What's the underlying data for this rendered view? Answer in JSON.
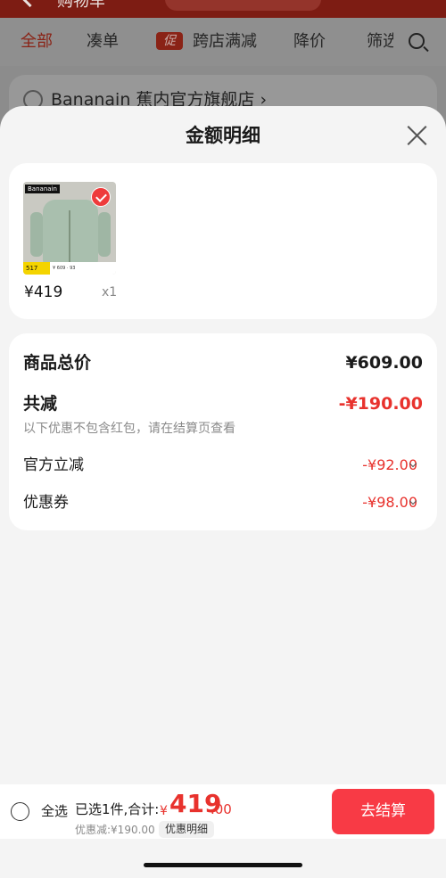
{
  "background": {
    "header_title": "购物车",
    "tabs": [
      "全部",
      "凑单",
      "跨店满减",
      "降价",
      "筛选"
    ],
    "promo_badge": "促",
    "store_name": "Bananain 蕉内官方旗舰店 ›"
  },
  "sheet": {
    "title": "金额明细",
    "product": {
      "price": "¥419",
      "quantity": "x1",
      "thumb_brand": "Bananain",
      "thumb_badge": "517",
      "thumb_strip": "¥ 609 · 93"
    },
    "breakdown": {
      "total_label": "商品总价",
      "total_value": "¥609.00",
      "reduce_label": "共减",
      "reduce_value": "-¥190.00",
      "reduce_note": "以下优惠不包含红包，请在结算页查看",
      "items": [
        {
          "label": "官方立减",
          "value": "-¥92.00"
        },
        {
          "label": "优惠券",
          "value": "-¥98.00"
        }
      ]
    }
  },
  "bottom_bar": {
    "select_all": "全选",
    "summary": "已选1件,合计:",
    "currency": "¥",
    "amount_int": "419",
    "amount_dec": ".00",
    "discount": "优惠减:¥190.00",
    "detail_chip": "优惠明细",
    "checkout": "去结算"
  },
  "colors": {
    "accent_red": "#e8322d",
    "checkout_button": "#f83a45"
  }
}
